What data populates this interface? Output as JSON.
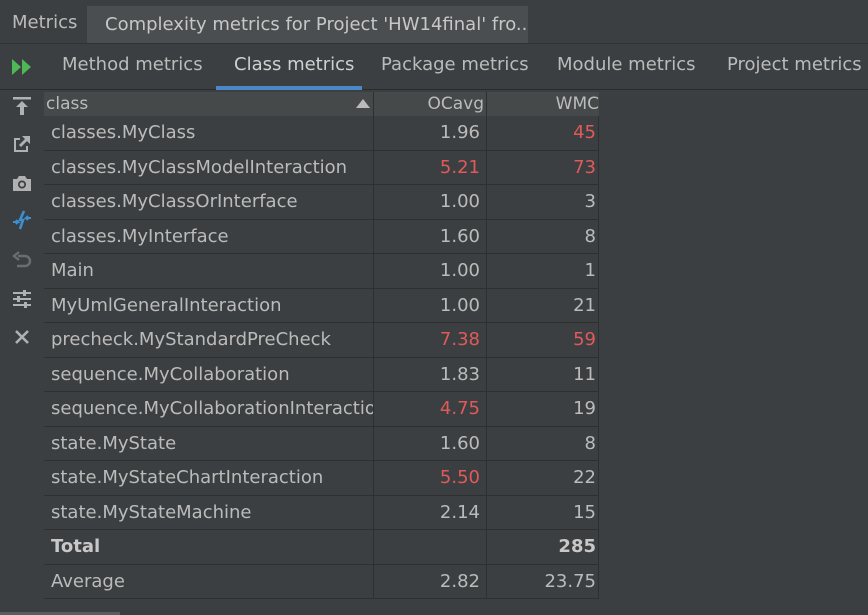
{
  "window": {
    "tool_name": "Metrics",
    "content_title": "Complexity metrics for Project 'HW14final' fro..."
  },
  "tabs": [
    {
      "label": "Method metrics",
      "active": false
    },
    {
      "label": "Class metrics",
      "active": true
    },
    {
      "label": "Package metrics",
      "active": false
    },
    {
      "label": "Module metrics",
      "active": false
    },
    {
      "label": "Project metrics",
      "active": false
    }
  ],
  "toolbar": [
    {
      "name": "export-icon"
    },
    {
      "name": "open-external-icon"
    },
    {
      "name": "camera-icon"
    },
    {
      "name": "compare-icon"
    },
    {
      "name": "undo-icon"
    },
    {
      "name": "settings-sliders-icon"
    },
    {
      "name": "close-icon"
    }
  ],
  "colors": {
    "accent": "#4a88c7",
    "warning": "#e05a5a",
    "run": "#4fb856"
  },
  "table": {
    "headers": [
      "class",
      "OCavg",
      "WMC"
    ],
    "sort_column": "class",
    "sort_direction": "ascending",
    "rows": [
      {
        "name": "classes.MyClass",
        "ocavg": "1.96",
        "wmc": "45",
        "ocavg_warn": false,
        "wmc_warn": true
      },
      {
        "name": "classes.MyClassModelInteraction",
        "ocavg": "5.21",
        "wmc": "73",
        "ocavg_warn": true,
        "wmc_warn": true
      },
      {
        "name": "classes.MyClassOrInterface",
        "ocavg": "1.00",
        "wmc": "3",
        "ocavg_warn": false,
        "wmc_warn": false
      },
      {
        "name": "classes.MyInterface",
        "ocavg": "1.60",
        "wmc": "8",
        "ocavg_warn": false,
        "wmc_warn": false
      },
      {
        "name": "Main",
        "ocavg": "1.00",
        "wmc": "1",
        "ocavg_warn": false,
        "wmc_warn": false
      },
      {
        "name": "MyUmlGeneralInteraction",
        "ocavg": "1.00",
        "wmc": "21",
        "ocavg_warn": false,
        "wmc_warn": false
      },
      {
        "name": "precheck.MyStandardPreCheck",
        "ocavg": "7.38",
        "wmc": "59",
        "ocavg_warn": true,
        "wmc_warn": true
      },
      {
        "name": "sequence.MyCollaboration",
        "ocavg": "1.83",
        "wmc": "11",
        "ocavg_warn": false,
        "wmc_warn": false
      },
      {
        "name": "sequence.MyCollaborationInteraction",
        "ocavg": "4.75",
        "wmc": "19",
        "ocavg_warn": true,
        "wmc_warn": false
      },
      {
        "name": "state.MyState",
        "ocavg": "1.60",
        "wmc": "8",
        "ocavg_warn": false,
        "wmc_warn": false
      },
      {
        "name": "state.MyStateChartInteraction",
        "ocavg": "5.50",
        "wmc": "22",
        "ocavg_warn": true,
        "wmc_warn": false
      },
      {
        "name": "state.MyStateMachine",
        "ocavg": "2.14",
        "wmc": "15",
        "ocavg_warn": false,
        "wmc_warn": false
      }
    ],
    "total": {
      "label": "Total",
      "ocavg": "",
      "wmc": "285"
    },
    "average": {
      "label": "Average",
      "ocavg": "2.82",
      "wmc": "23.75"
    }
  }
}
